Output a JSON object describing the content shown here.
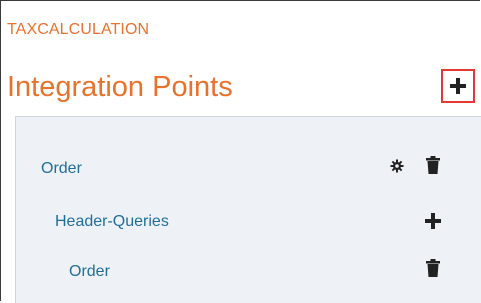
{
  "header": {
    "app_name": "TAXCALCULATION",
    "section_title": "Integration Points",
    "add_icon": "plus-icon"
  },
  "tree": {
    "items": [
      {
        "label": "Order",
        "level": 1,
        "actions": [
          "gear-icon",
          "trash-icon"
        ]
      },
      {
        "label": "Header-Queries",
        "level": 2,
        "actions": [
          "plus-icon"
        ]
      },
      {
        "label": "Order",
        "level": 3,
        "actions": [
          "trash-icon"
        ]
      }
    ]
  },
  "colors": {
    "accent_orange": "#e8722c",
    "link_blue": "#1f6e99",
    "panel_bg": "#eef2f6",
    "highlight_red": "#e53935",
    "icon_dark": "#222222"
  }
}
